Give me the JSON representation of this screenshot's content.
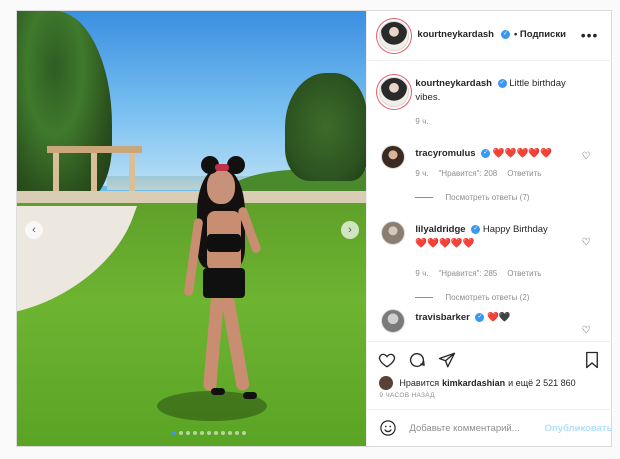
{
  "post": {
    "author": "kourtneykardash",
    "follow_label": "• Подписки",
    "caption": "Little birthday vibes.",
    "caption_time": "9 ч."
  },
  "comments": [
    {
      "username": "tracyromulus",
      "text": "❤️❤️❤️❤️❤️",
      "time": "9 ч.",
      "likes": "\"Нравится\": 208",
      "reply_label": "Ответить",
      "view_replies": "Посмотреть ответы (7)"
    },
    {
      "username": "lilyaldridge",
      "text_prefix": "Happy Birthday",
      "text_hearts": "❤️❤️❤️❤️❤️",
      "time": "9 ч.",
      "likes": "\"Нравится\": 285",
      "reply_label": "Ответить",
      "view_replies": "Посмотреть ответы (2)"
    },
    {
      "username": "travisbarker",
      "text": "❤️🖤"
    }
  ],
  "likes_bar": {
    "prefix": "Нравится",
    "user": "kimkardashian",
    "suffix": "и ещё 2 521 860"
  },
  "timestamp": "9 ЧАСОВ НАЗАД",
  "comment_box": {
    "placeholder": "Добавьте комментарий...",
    "publish_label": "Опубликовать"
  },
  "carousel": {
    "total_slides": 11,
    "active_index": 0
  },
  "colors": {
    "link_blue": "#3897f0",
    "heart_red": "#ed3c4a",
    "publish_disabled": "#b2dffc"
  }
}
